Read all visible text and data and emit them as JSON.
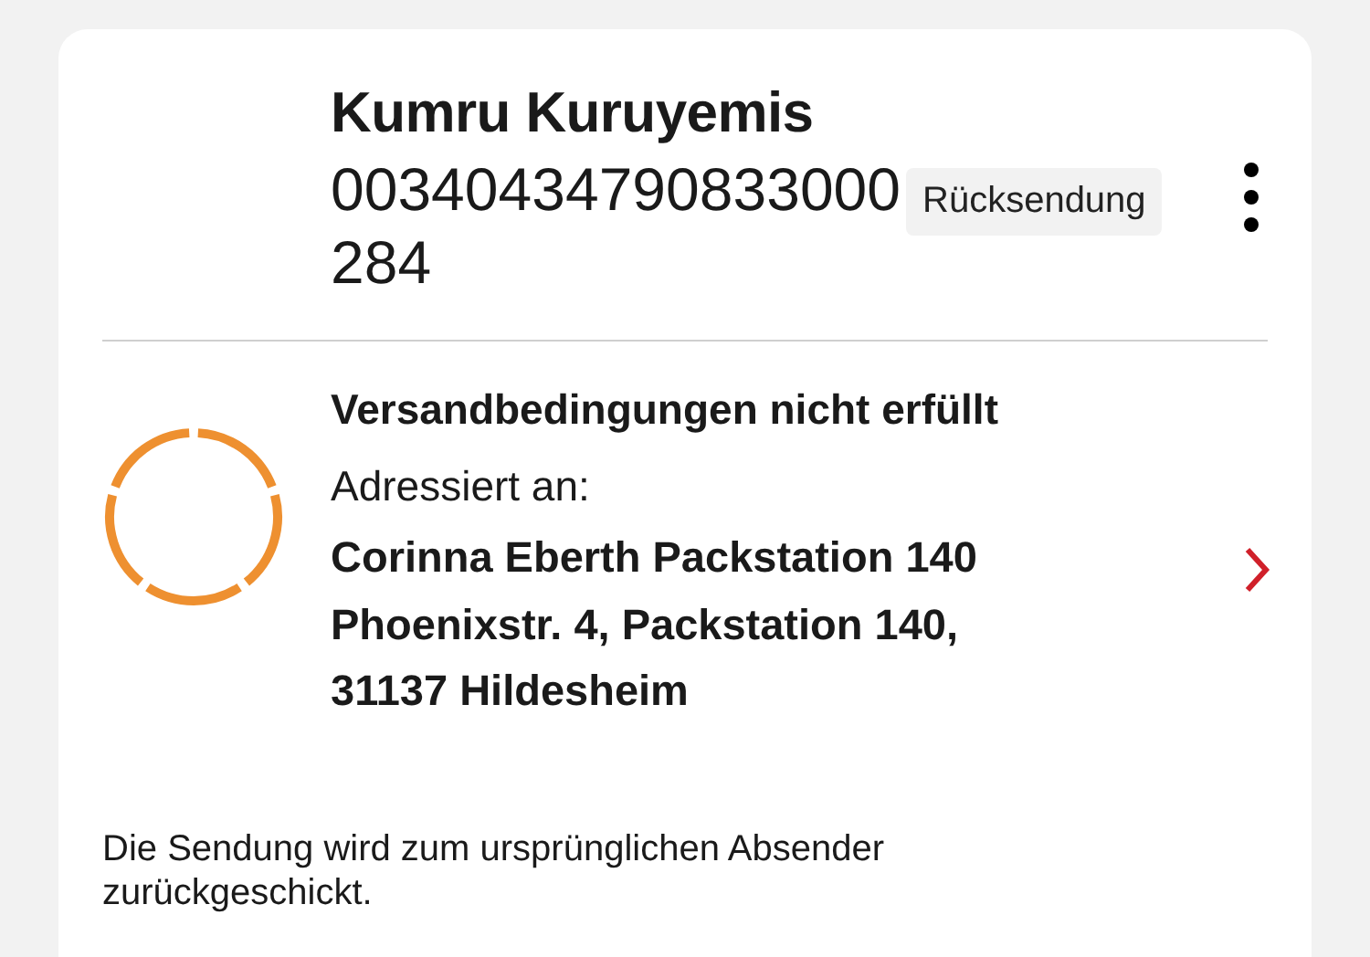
{
  "header": {
    "name": "Kumru Kuruyemis",
    "tracking_number": "00340434790833000284",
    "badge": "Rücksendung"
  },
  "status": {
    "title": "Versandbedingungen nicht erfüllt",
    "address_label": "Adressiert an:",
    "address_lines": [
      "Corinna Eberth Packstation 140",
      "Phoenixstr. 4, Packstation 140,",
      "31137 Hildesheim"
    ]
  },
  "note": "Die Sendung wird zum ursprünglichen Absender zurückgeschickt."
}
